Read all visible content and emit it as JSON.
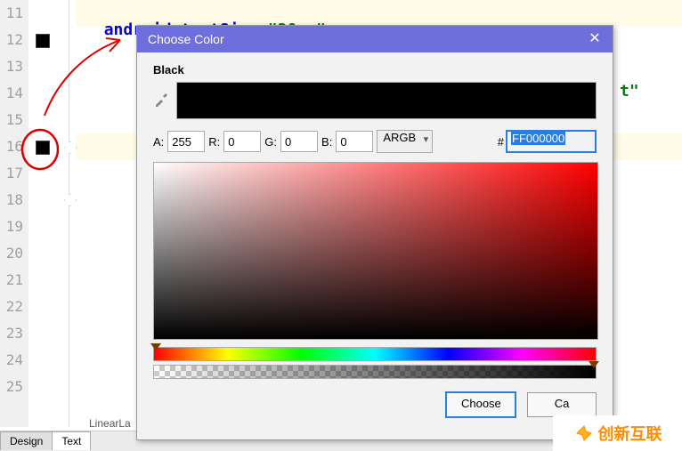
{
  "gutter": [
    "11",
    "12",
    "13",
    "14",
    "15",
    "16",
    "17",
    "18",
    "19",
    "20",
    "21",
    "22",
    "23",
    "24",
    "25"
  ],
  "code_attr": "android:textSize",
  "code_eq": "=",
  "code_val": "\"20sp\"",
  "peek1": "\"",
  "peek2": "t\"",
  "peek3": "\"",
  "crumb": "LinearLa",
  "tabs": {
    "design": "Design",
    "text": "Text"
  },
  "dialog": {
    "title": "Choose Color",
    "close": "✕",
    "color_name": "Black",
    "labels": {
      "a": "A:",
      "r": "R:",
      "g": "G:",
      "b": "B:",
      "hash": "#"
    },
    "values": {
      "a": "255",
      "r": "0",
      "g": "0",
      "b": "0",
      "hex": "FF000000",
      "mode": "ARGB"
    },
    "buttons": {
      "choose": "Choose",
      "cancel": "Ca"
    }
  },
  "logo_text": "创新互联"
}
